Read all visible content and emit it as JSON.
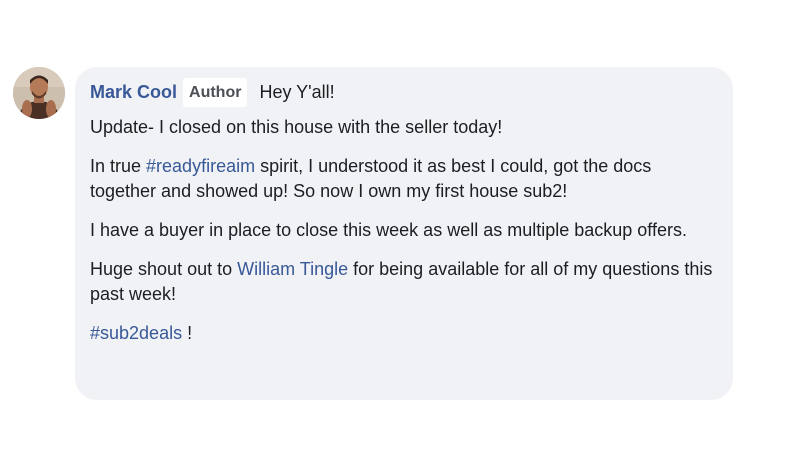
{
  "comment": {
    "author": "Mark Cool",
    "badge": "Author",
    "greeting": "Hey Y'all!",
    "paragraphs": {
      "p1": "Update- I closed on this house with the seller today!",
      "p2_before": "In true ",
      "p2_hashtag": "#readyfireaim",
      "p2_after": " spirit, I understood it as best I could, got the docs together and showed up! So now I own my first house sub2!",
      "p3": "I have a buyer in place to close this week as well as multiple backup offers.",
      "p4_before": "Huge shout out to ",
      "p4_mention": "William Tingle",
      "p4_after": " for being available for all of my questions this past week!",
      "p5_hashtag": "#sub2deals",
      "p5_after": " !"
    }
  },
  "colors": {
    "link": "#385898",
    "bubble_background": "#f0f2f5",
    "text": "#1c1e21"
  },
  "icons": {
    "avatar": "profile-photo"
  }
}
